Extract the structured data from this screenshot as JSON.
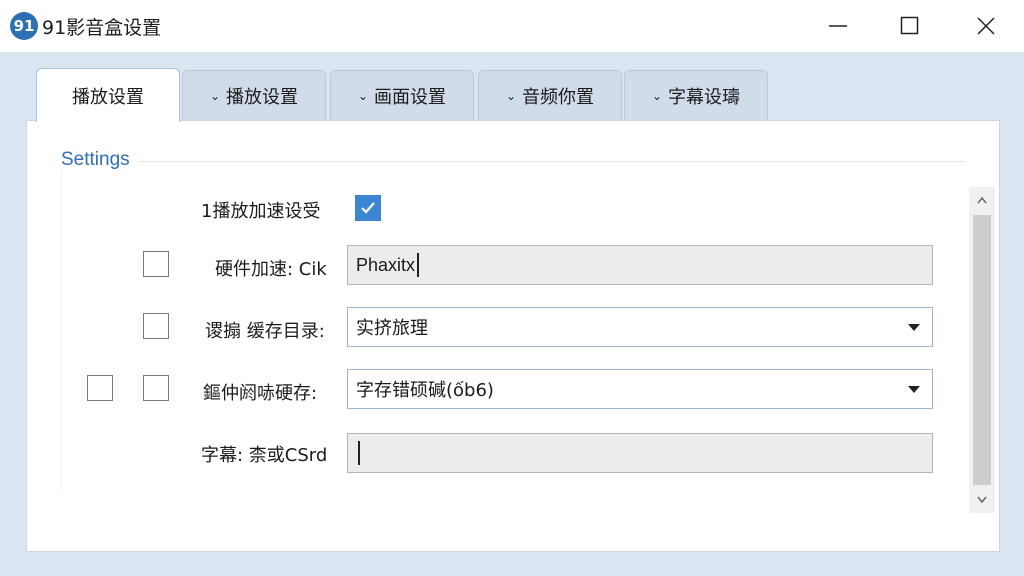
{
  "window": {
    "title": "91影音盒设置",
    "icon_text": "91",
    "icon_color": "#2f6fb3"
  },
  "tabs": [
    {
      "label": "播放设置",
      "active": true
    },
    {
      "label": "播放设置",
      "active": false
    },
    {
      "label": "画面设置",
      "active": false
    },
    {
      "label": "音频你置",
      "active": false
    },
    {
      "label": "字幕设璹",
      "active": false
    }
  ],
  "group": {
    "title": "Settings"
  },
  "rows": {
    "playback_accel": {
      "label": "1播放加速设受",
      "checked": true
    },
    "hw_accel": {
      "label": "硬件加速: Cik",
      "value": "Phaxitx"
    },
    "cache_dir": {
      "label": "谡搧 缓存目录:",
      "value": "实挤旅理"
    },
    "cache_hw": {
      "label": "鏂仲阏哧硬存:",
      "value": "字存错硕碱(ốb6)"
    },
    "subtitle": {
      "label": "字幕: 柰或CSrd",
      "value": ""
    }
  },
  "colors": {
    "accent": "#2f6fb3",
    "check": "#3a86d0",
    "background": "#d9e6f2"
  }
}
